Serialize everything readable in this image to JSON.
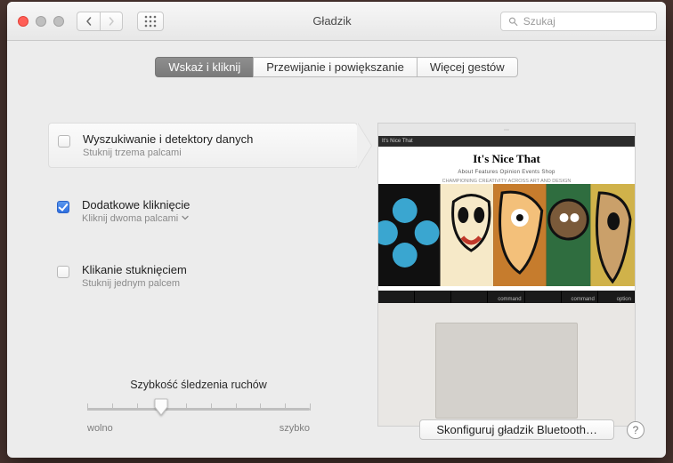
{
  "window": {
    "title": "Gładzik",
    "search_placeholder": "Szukaj"
  },
  "tabs": [
    {
      "label": "Wskaż i kliknij",
      "active": true
    },
    {
      "label": "Przewijanie i powiększanie",
      "active": false
    },
    {
      "label": "Więcej gestów",
      "active": false
    }
  ],
  "options": [
    {
      "title": "Wyszukiwanie i detektory danych",
      "subtitle": "Stuknij trzema palcami",
      "checked": false,
      "has_menu": false
    },
    {
      "title": "Dodatkowe kliknięcie",
      "subtitle": "Kliknij dwoma palcami",
      "checked": true,
      "has_menu": true
    },
    {
      "title": "Klikanie stuknięciem",
      "subtitle": "Stuknij jednym palcem",
      "checked": false,
      "has_menu": false
    }
  ],
  "tracking": {
    "label": "Szybkość śledzenia ruchów",
    "slow": "wolno",
    "fast": "szybko",
    "ticks": 10,
    "value": 3
  },
  "preview": {
    "site_title": "It's Nice That",
    "site_nav": "About  Features  Opinion  Events  Shop",
    "tagline": "CHAMPIONING CREATIVITY ACROSS ART AND DESIGN",
    "keycaps": [
      "",
      "",
      "",
      "command",
      "",
      "command",
      "option"
    ]
  },
  "footer": {
    "bluetooth_button": "Skonfiguruj gładzik Bluetooth…",
    "help": "?"
  }
}
